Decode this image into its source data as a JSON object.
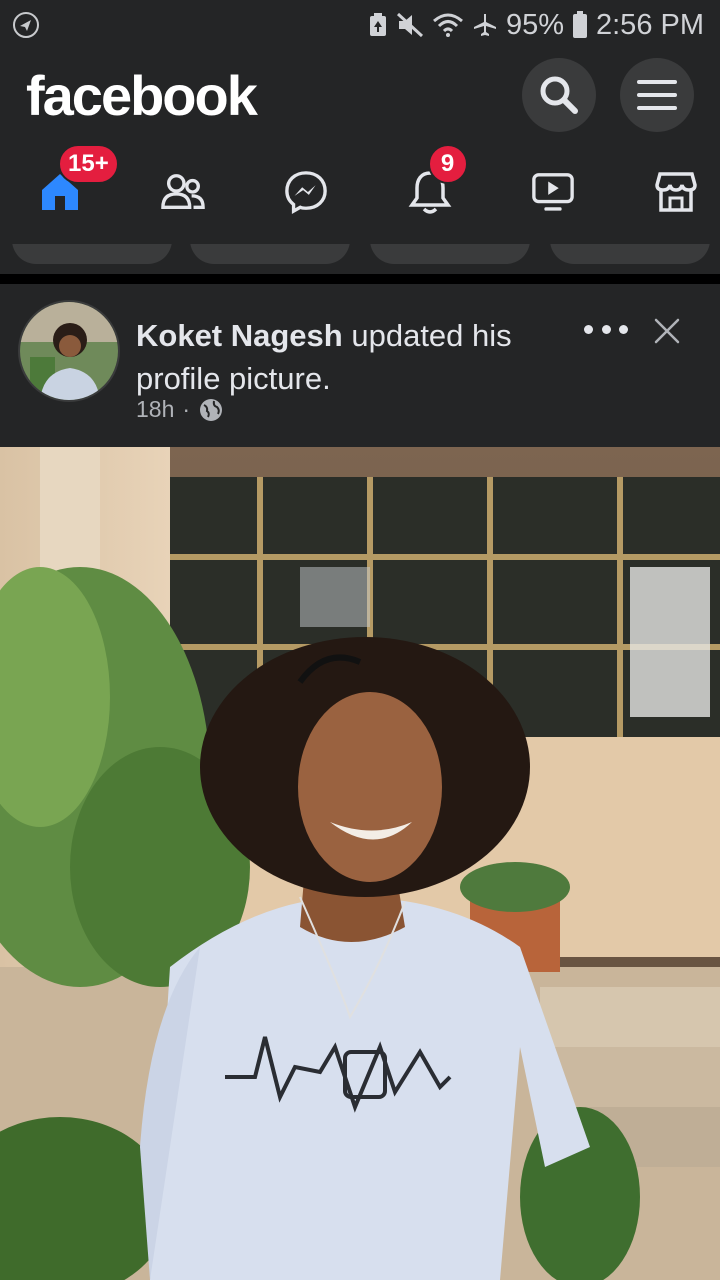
{
  "status_bar": {
    "battery": "95%",
    "time": "2:56 PM"
  },
  "app_bar": {
    "logo": "facebook"
  },
  "tabs": {
    "home_badge": "15+",
    "notifications_badge": "9"
  },
  "post": {
    "author": "Koket Nagesh",
    "action": "updated his profile picture.",
    "time": "18h"
  },
  "colors": {
    "background": "#18191a",
    "surface": "#242526",
    "accent": "#1877f2",
    "badge": "#e41e3f"
  }
}
